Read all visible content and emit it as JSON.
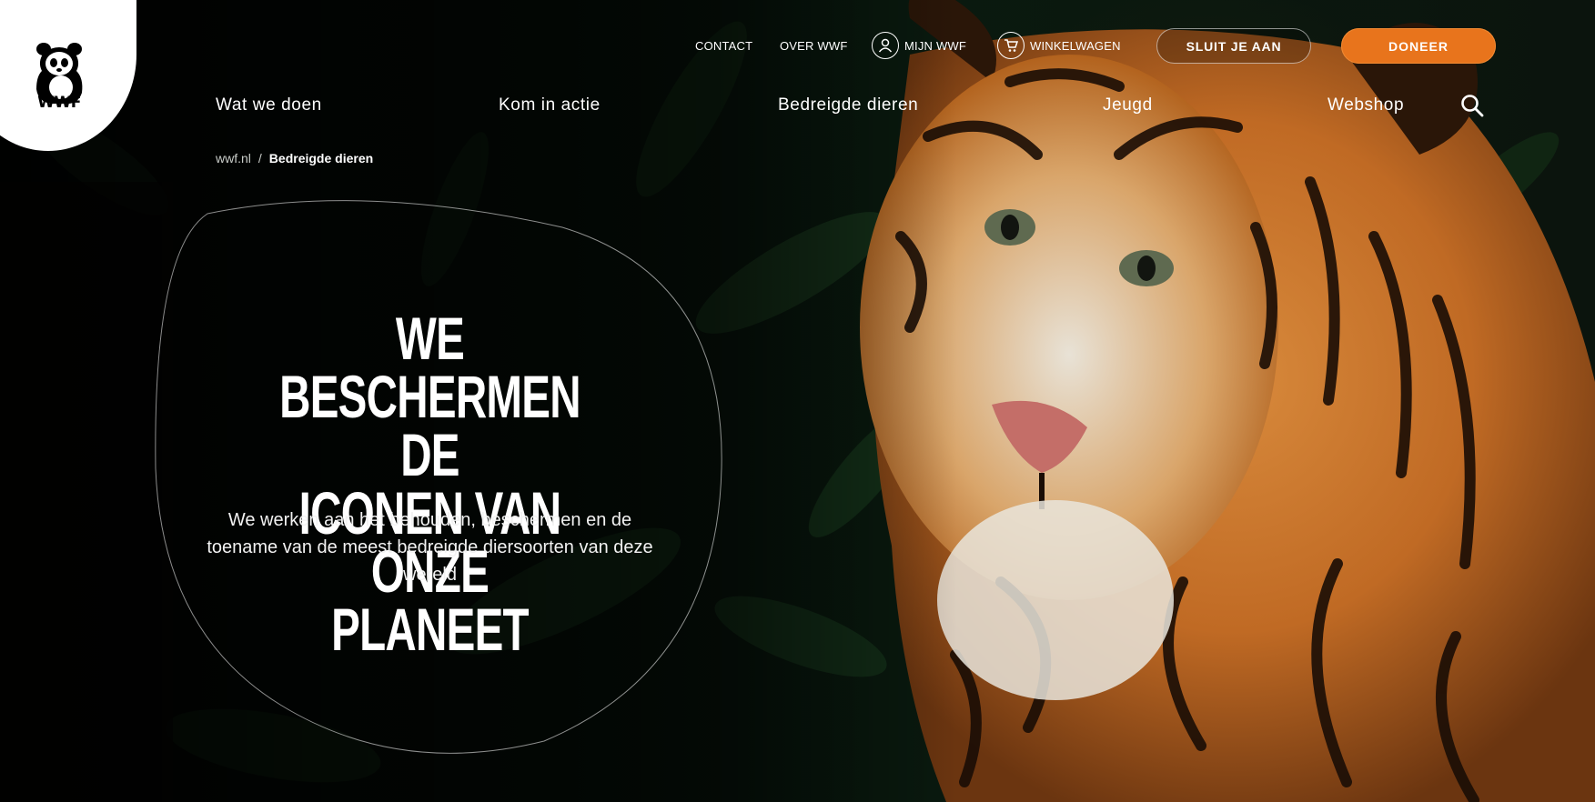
{
  "logo": {
    "text": "WWF"
  },
  "utility_nav": {
    "contact": "CONTACT",
    "over": "OVER WWF",
    "account": "MIJN WWF",
    "cart": "WINKELWAGEN",
    "join": "SLUIT JE AAN",
    "donate": "DONEER"
  },
  "main_nav": {
    "items": [
      "Wat we doen",
      "Kom in actie",
      "Bedreigde dieren",
      "Jeugd",
      "Webshop"
    ]
  },
  "breadcrumb": {
    "home": "wwf.nl",
    "separator": "/",
    "current": "Bedreigde dieren"
  },
  "hero": {
    "headline_lines": [
      "WE BESCHERMEN DE",
      "ICONEN VAN ONZE",
      "PLANEET"
    ],
    "subtitle": "We werken aan het behouden, beschermen en de toename van de meest bedreigde diersoorten van deze wereld"
  },
  "colors": {
    "accent": "#e8741c",
    "background": "#07110a",
    "text": "#ffffff"
  },
  "icons": {
    "account": "user-circle-icon",
    "cart": "cart-icon",
    "search": "search-icon"
  }
}
